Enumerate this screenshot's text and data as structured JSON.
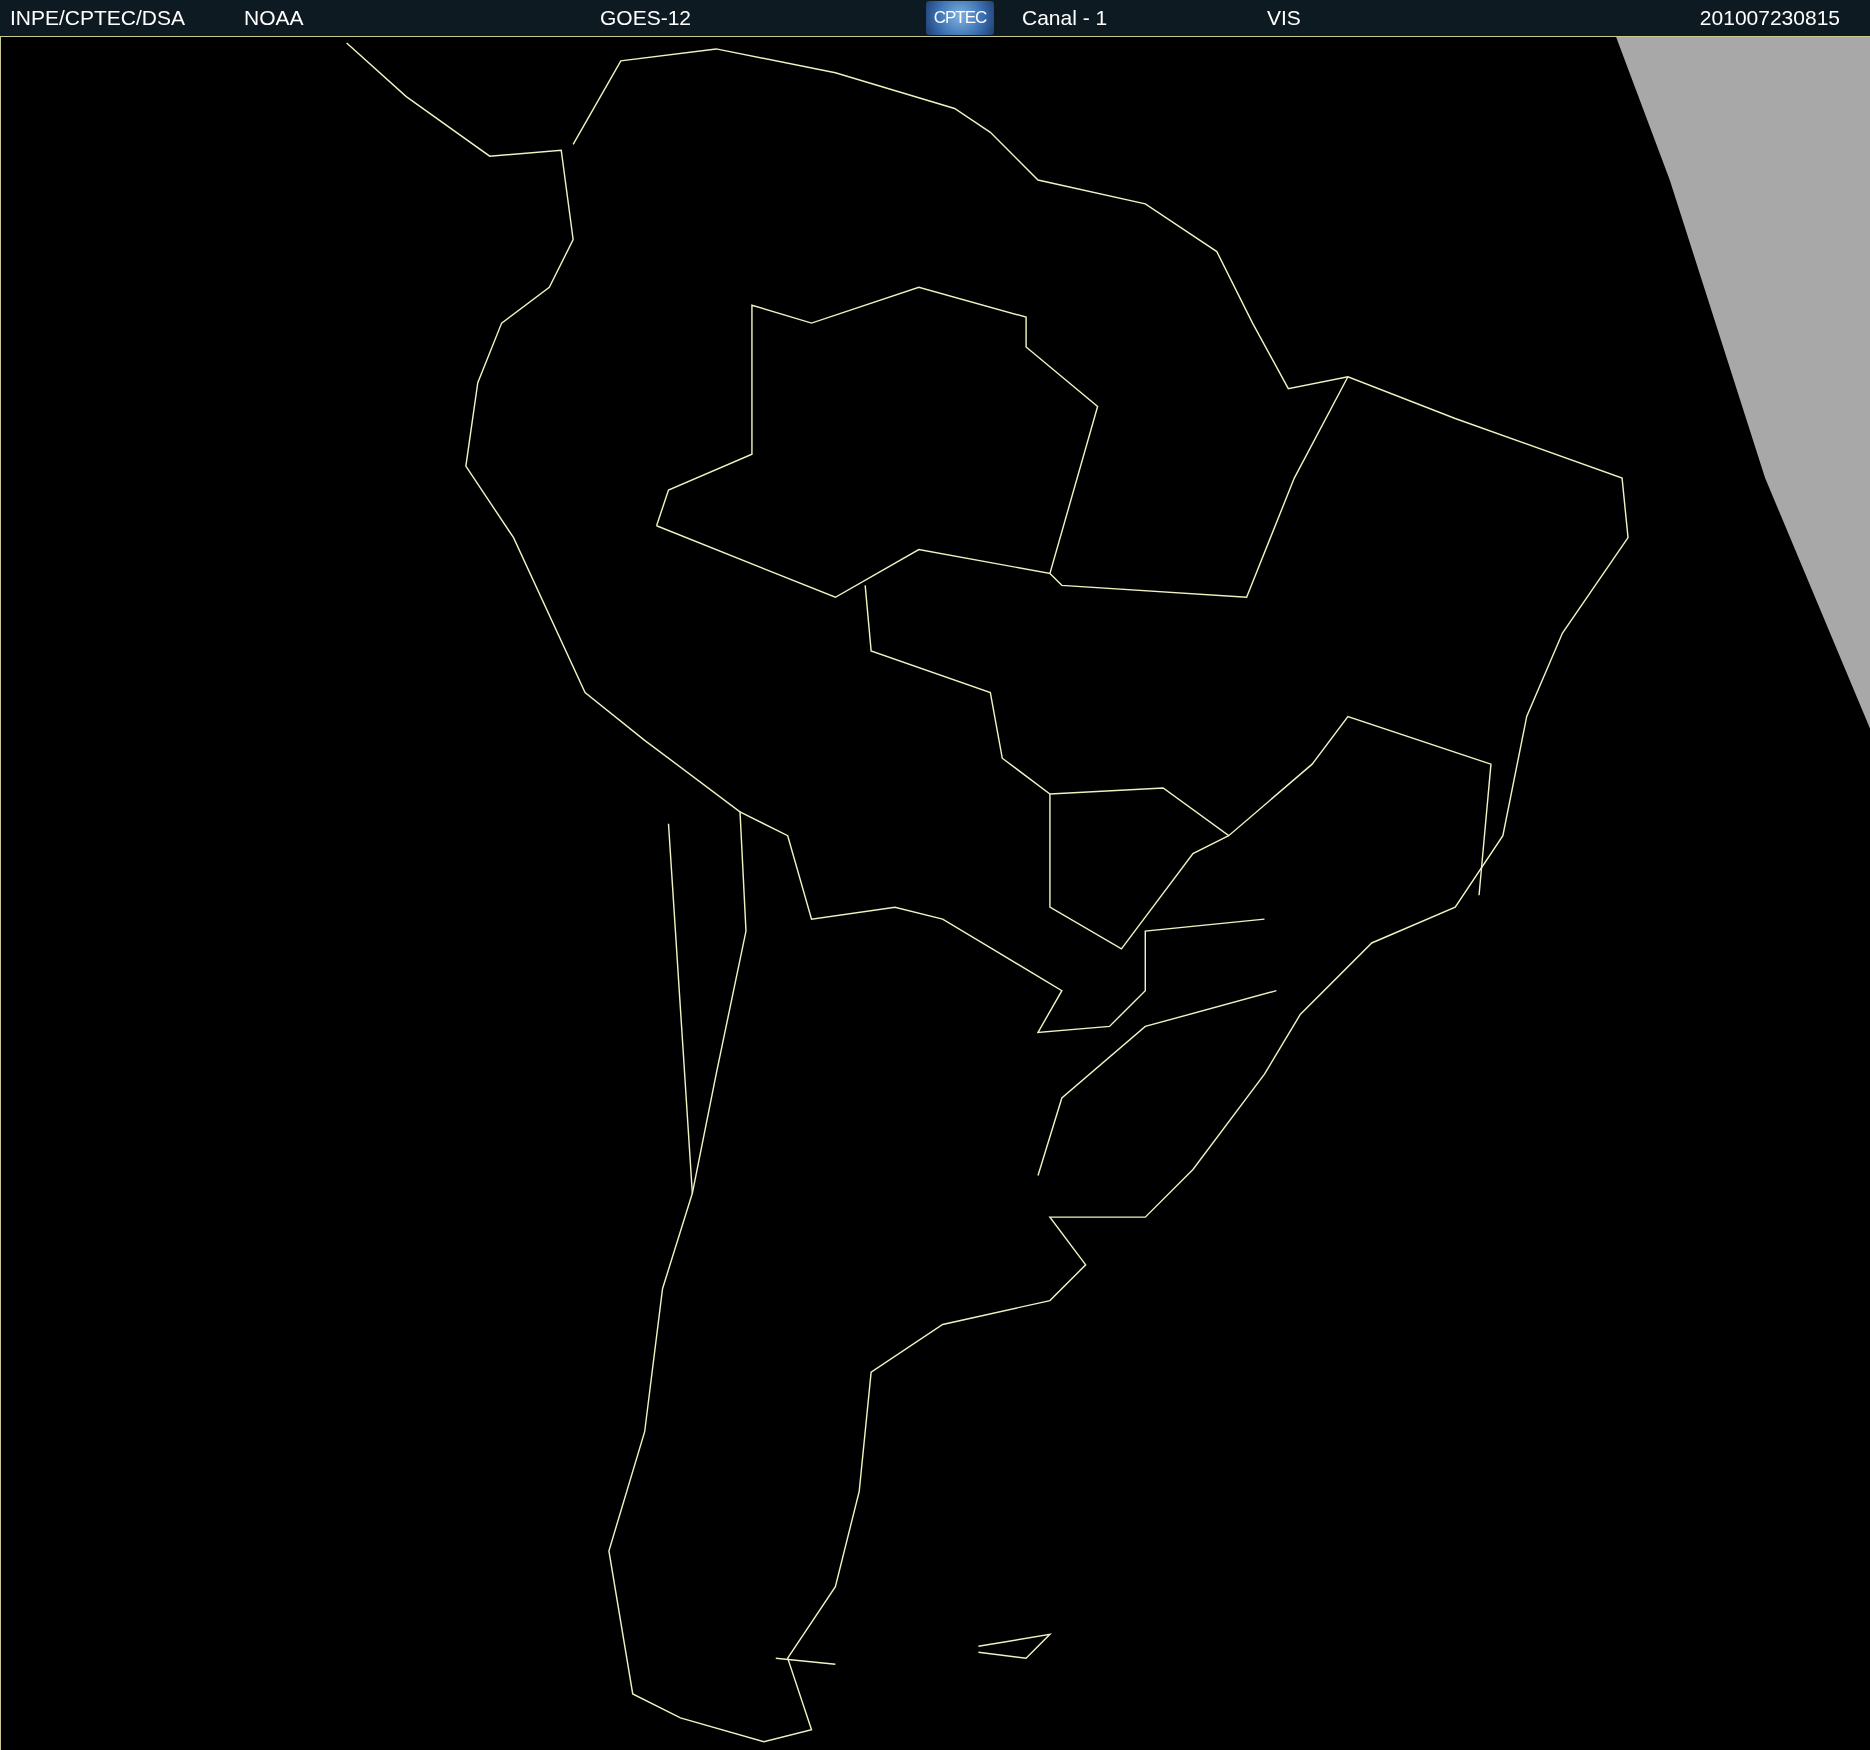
{
  "header": {
    "items": [
      {
        "kind": "text",
        "label": "INPE/CPTEC/DSA"
      },
      {
        "kind": "text",
        "label": "NOAA"
      },
      {
        "kind": "text",
        "label": "GOES-12"
      },
      {
        "kind": "logo",
        "label": "CPTEC"
      },
      {
        "kind": "text",
        "label": "Canal - 1"
      },
      {
        "kind": "text",
        "label": "VIS"
      },
      {
        "kind": "text",
        "label": "201007230815"
      }
    ]
  }
}
